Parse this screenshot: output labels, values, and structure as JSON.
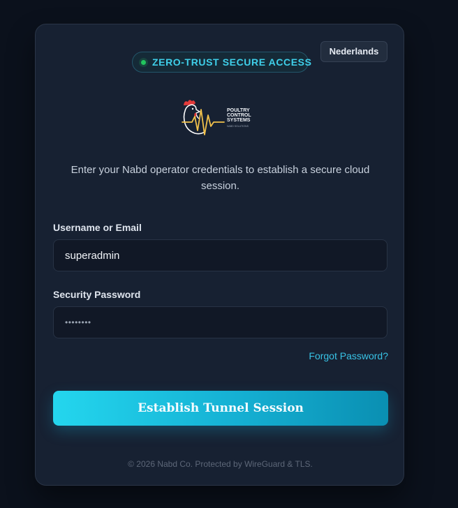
{
  "header": {
    "language_label": "Nederlands",
    "badge_text": "ZERO-TRUST SECURE ACCESS"
  },
  "logo": {
    "name_lines": [
      "POULTRY",
      "CONTROL",
      "SYSTEMS"
    ],
    "tagline": "NABD SOLUTIONS",
    "icon": "rooster-heartbeat-icon"
  },
  "intro": "Enter your Nabd operator credentials to establish a secure cloud session.",
  "form": {
    "username_label": "Username or Email",
    "username_value": "superadmin",
    "password_label": "Security Password",
    "password_value": "••••••••",
    "forgot_label": "Forgot Password?",
    "submit_label": "Establish Tunnel Session"
  },
  "footer": "© 2026 Nabd Co. Protected by WireGuard & TLS.",
  "colors": {
    "background": "#0b111c",
    "card": "#172132",
    "accent": "#22d3ee",
    "status_dot": "#22c55e"
  }
}
